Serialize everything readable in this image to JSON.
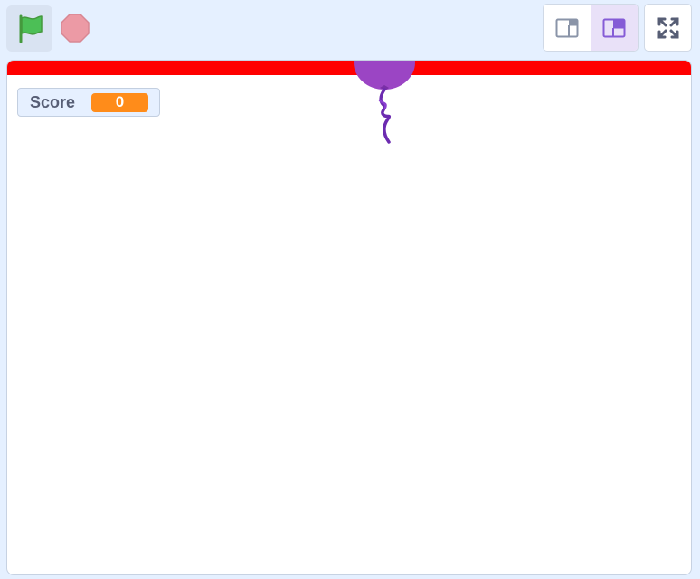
{
  "toolbar": {
    "green_flag_icon": "green-flag-icon",
    "stop_icon": "stop-icon",
    "small_stage_icon": "small-stage-icon",
    "normal_stage_icon": "normal-stage-icon",
    "fullscreen_icon": "fullscreen-icon",
    "active_layout": "normal-stage"
  },
  "stage": {
    "monitor": {
      "label": "Score",
      "value": "0"
    },
    "sprites": [
      "balloon"
    ]
  },
  "colors": {
    "background": "#e5f0ff",
    "red_bar": "#ff0000",
    "balloon": "#9b45c4",
    "monitor_value": "#ff8c1a",
    "flag": "#4cbf56",
    "stop": "#ec9aa5",
    "active_layout": "#855cd6"
  }
}
